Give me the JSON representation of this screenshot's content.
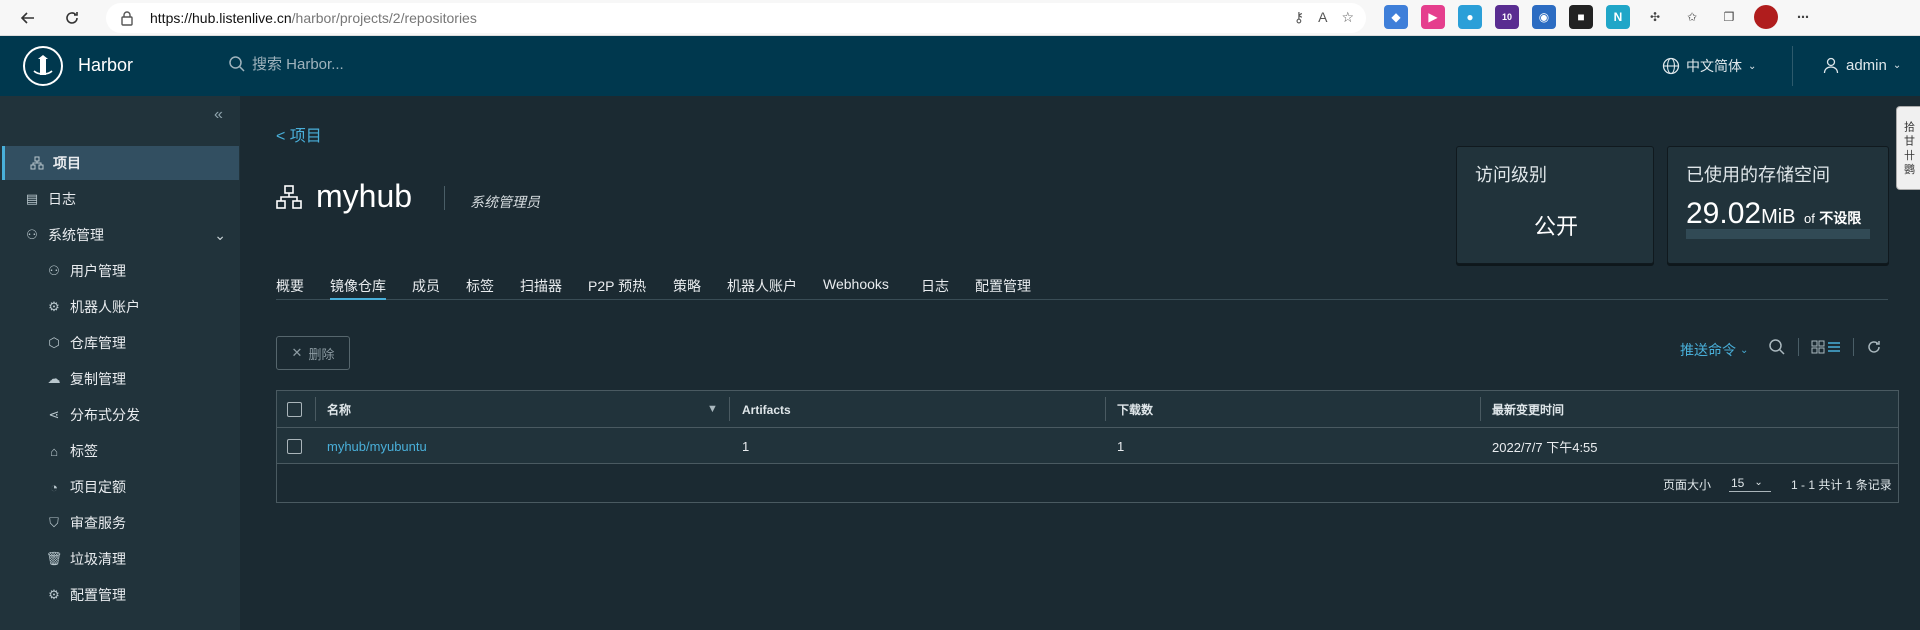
{
  "browser": {
    "url_host": "https://hub.listenlive.cn",
    "url_path": "/harbor/projects/2/repositories",
    "ext_badge": "10"
  },
  "header": {
    "brand": "Harbor",
    "search_placeholder": "搜索 Harbor...",
    "language": "中文简体",
    "user": "admin"
  },
  "sidebar": {
    "items": [
      {
        "label": "项目",
        "icon": "projects-icon"
      },
      {
        "label": "日志",
        "icon": "log-icon"
      },
      {
        "label": "系统管理",
        "icon": "admin-icon"
      },
      {
        "label": "用户管理",
        "icon": "users-icon"
      },
      {
        "label": "机器人账户",
        "icon": "robot-icon"
      },
      {
        "label": "仓库管理",
        "icon": "registry-icon"
      },
      {
        "label": "复制管理",
        "icon": "replication-icon"
      },
      {
        "label": "分布式分发",
        "icon": "distribution-icon"
      },
      {
        "label": "标签",
        "icon": "tag-icon"
      },
      {
        "label": "项目定额",
        "icon": "quota-icon"
      },
      {
        "label": "审查服务",
        "icon": "shield-icon"
      },
      {
        "label": "垃圾清理",
        "icon": "trash-icon"
      },
      {
        "label": "配置管理",
        "icon": "gear-icon"
      }
    ]
  },
  "main": {
    "breadcrumb": "< 项目",
    "project_name": "myhub",
    "role": "系统管理员",
    "access_card": {
      "title": "访问级别",
      "value": "公开"
    },
    "storage_card": {
      "title": "已使用的存储空间",
      "amount": "29.02",
      "unit": "MiB",
      "of": "of",
      "limit": "不设限"
    },
    "tabs": [
      "概要",
      "镜像仓库",
      "成员",
      "标签",
      "扫描器",
      "P2P 预热",
      "策略",
      "机器人账户",
      "Webhooks",
      "日志",
      "配置管理"
    ],
    "active_tab": 1,
    "delete_button": "删除",
    "push_command": "推送命令",
    "table": {
      "headers": [
        "名称",
        "Artifacts",
        "下载数",
        "最新变更时间"
      ],
      "rows": [
        {
          "name": "myhub/myubuntu",
          "artifacts": "1",
          "downloads": "1",
          "updated": "2022/7/7 下午4:55"
        }
      ],
      "page_size_label": "页面大小",
      "page_size": "15",
      "count": "1 - 1 共计 1 条记录"
    }
  },
  "side_tab": "拾 甘 卄 鹦"
}
